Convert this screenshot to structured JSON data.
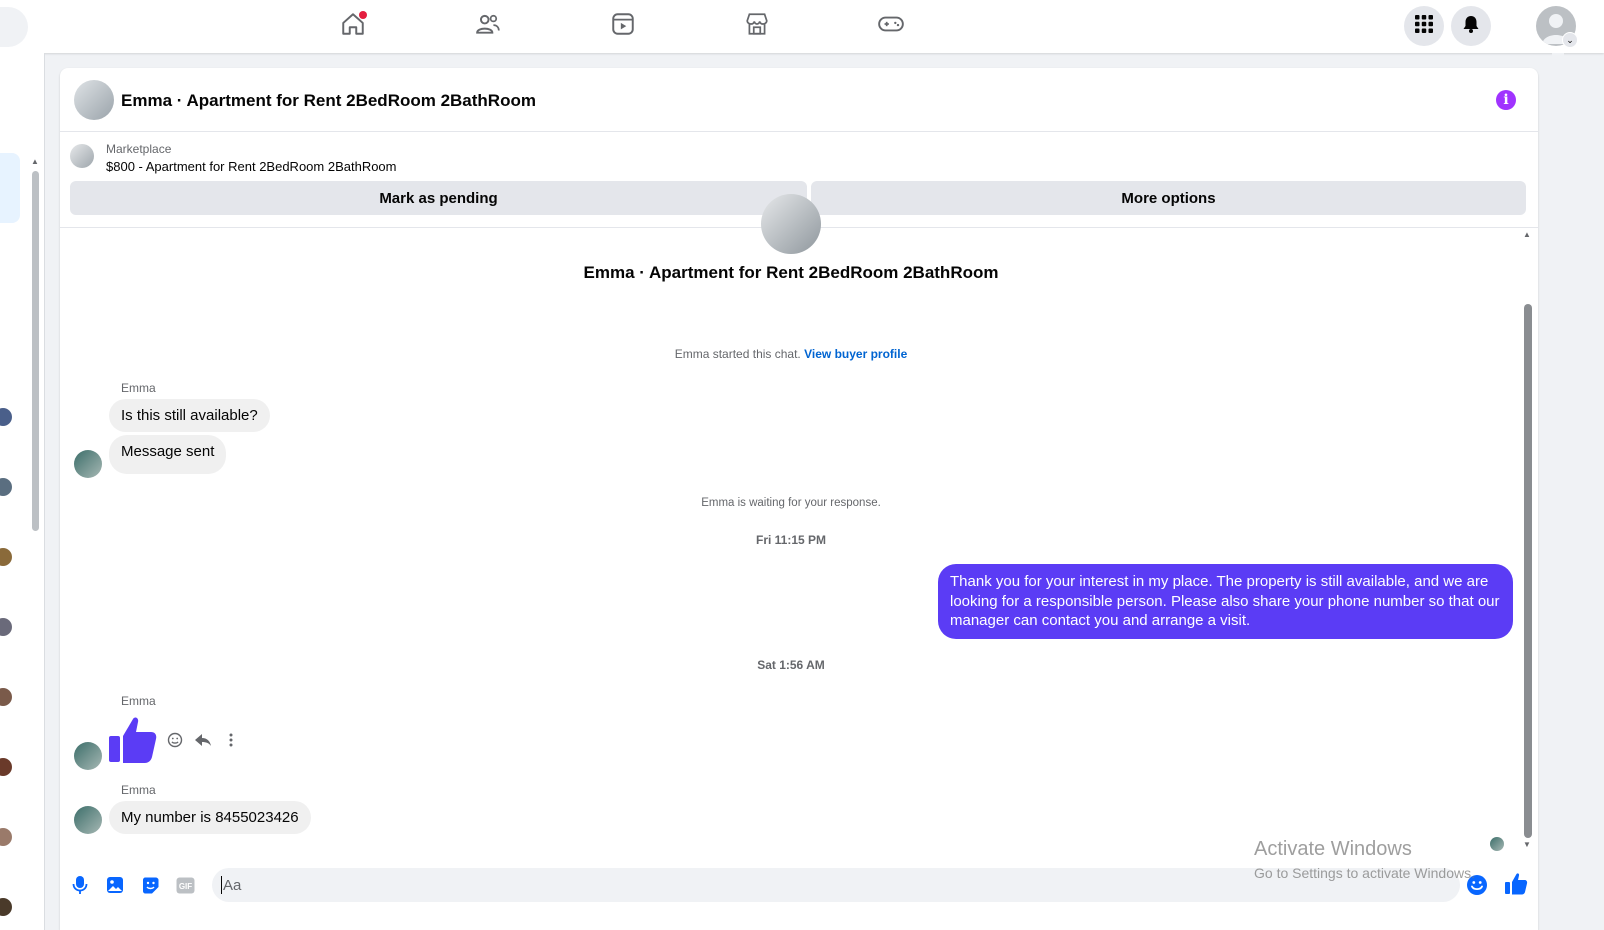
{
  "nav": {
    "icons": [
      "home-icon",
      "friends-icon",
      "video-icon",
      "marketplace-icon",
      "gaming-icon"
    ],
    "right_icons": [
      "menu-grid-icon",
      "notifications-icon",
      "account-icon"
    ]
  },
  "conversation": {
    "title": "Emma · Apartment for Rent 2BedRoom 2BathRoom",
    "listing": {
      "source": "Marketplace",
      "title": "$800 - Apartment for Rent 2BedRoom 2BathRoom"
    },
    "actions": {
      "mark_pending": "Mark as pending",
      "more_options": "More options"
    },
    "intro_title": "Emma · Apartment for Rent 2BedRoom 2BathRoom",
    "started_text": "Emma started this chat.",
    "buyer_profile_link": "View buyer profile",
    "waiting_text": "Emma is waiting for your response.",
    "messages": [
      {
        "sender": "Emma",
        "text": "Is this still available?"
      },
      {
        "text": "Message sent"
      },
      {
        "timestamp": "Fri 11:15 PM"
      },
      {
        "sender": "me",
        "text": "Thank you for your interest in my place. The property is still available, and we are looking for a responsible person. Please also share your phone number so that our manager can contact you and arrange a visit."
      },
      {
        "timestamp": "Sat 1:56 AM"
      },
      {
        "sender": "Emma",
        "sticker": "thumbs-up"
      },
      {
        "sender": "Emma",
        "text": "My number is 8455023426"
      }
    ]
  },
  "composer": {
    "placeholder": "Aa",
    "icons": [
      "microphone-icon",
      "photo-icon",
      "sticker-icon",
      "gif-icon",
      "emoji-icon",
      "like-icon"
    ],
    "gif_label": "GIF"
  },
  "watermark": {
    "title": "Activate Windows",
    "subtitle": "Go to Settings to activate Windows."
  },
  "colors": {
    "accent": "#0866ff",
    "outgoing_bubble": "#5b3cf5",
    "like_sticker": "#5b3cf5",
    "info": "#a033ff",
    "notification_dot": "#e41e3f"
  }
}
